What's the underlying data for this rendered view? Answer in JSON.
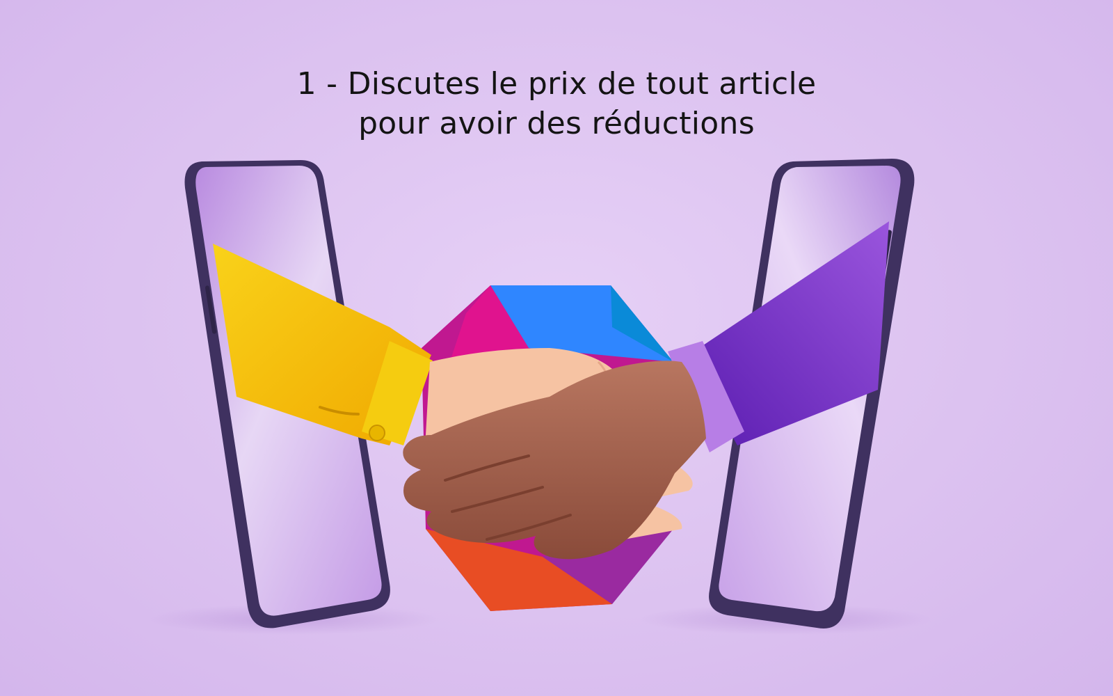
{
  "headline": {
    "line1": "1 - Discutes le prix de tout article",
    "line2": "pour avoir des réductions"
  },
  "colors": {
    "background": "#e2c9f2",
    "phone_frame": "#4a3b6b",
    "left_sleeve": "#f7c90e",
    "right_sleeve": "#8a3fd0",
    "hexagon_blue": "#2f86ff",
    "hexagon_pink": "#e0138e",
    "hexagon_orange": "#e84d24",
    "hexagon_purple": "#8a2fa8",
    "skin_light": "#f6c3a3",
    "skin_dark": "#a3624a"
  },
  "icons": {
    "left_phone": "smartphone-icon",
    "right_phone": "smartphone-icon",
    "handshake": "handshake-icon",
    "logo": "hexagon-logo"
  }
}
